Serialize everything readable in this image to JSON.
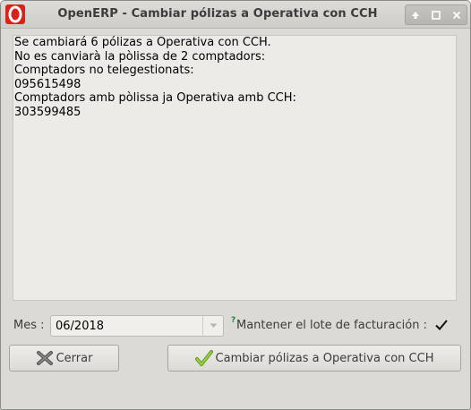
{
  "window": {
    "title": "OpenERP - Cambiar pólizas a Operativa con CCH",
    "icons": {
      "app": "openerp-logo",
      "up": "arrow-up-icon",
      "maximize": "maximize-icon",
      "close": "close-icon"
    }
  },
  "message": {
    "lines": [
      "Se cambiará 6 pólizas a Operativa con CCH.",
      "No es canviarà la pòlissa de 2 comptadors:",
      "Comptadors no telegestionats:",
      "095615498",
      "Comptadors amb pòlissa ja Operativa amb CCH:",
      "303599485"
    ]
  },
  "form": {
    "mes_label": "Mes :",
    "mes_value": "06/2018",
    "help_mark": "?",
    "mantener_label": "Mantener el lote de facturación :",
    "mantener_checked": true
  },
  "buttons": {
    "close_label": "Cerrar",
    "apply_label": "Cambiar pólizas a Operativa con CCH"
  },
  "colors": {
    "accent_red": "#d8231c",
    "check_green": "#7fbf2a",
    "help_green": "#1f8b33"
  }
}
